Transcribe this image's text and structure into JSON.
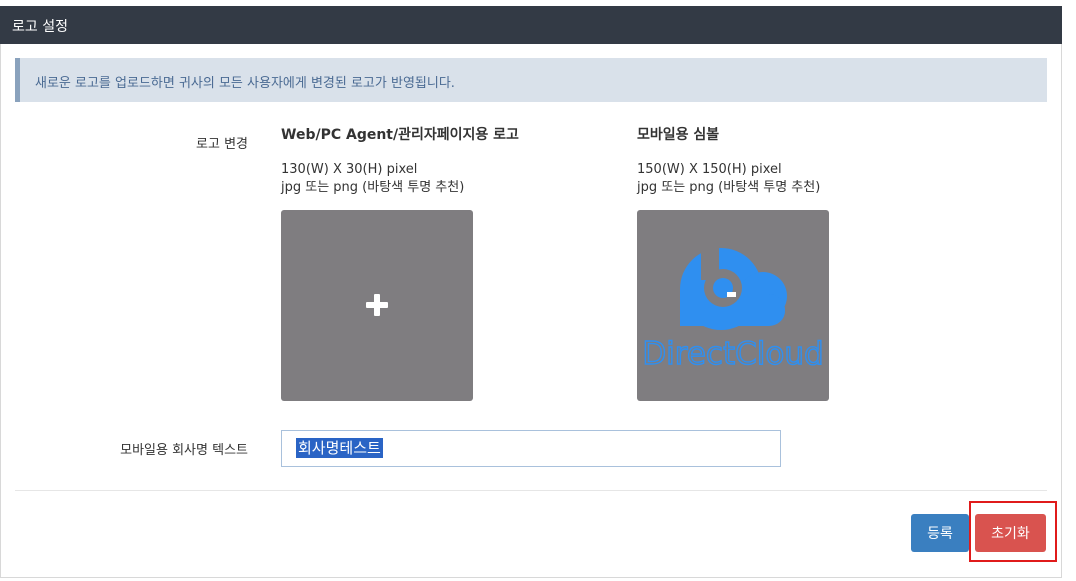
{
  "header": {
    "title": "로고 설정"
  },
  "notice": {
    "text": "새로운 로고를 업로드하면 귀사의 모든 사용자에게 변경된 로고가 반영됩니다."
  },
  "logo_section": {
    "label": "로고 변경",
    "web": {
      "title": "Web/PC Agent/관리자페이지용 로고",
      "size": "130(W) X 30(H) pixel",
      "format": "jpg 또는 png (바탕색 투명 추천)",
      "upload_icon": "plus-icon"
    },
    "mobile": {
      "title": "모바일용 심볼",
      "size": "150(W) X 150(H) pixel",
      "format": "jpg 또는 png (바탕색 투명 추천)",
      "logo_text": "DirectCloud",
      "logo_color": "#2f8ff0"
    }
  },
  "company_text": {
    "label": "모바일용 회사명 텍스트",
    "value": "회사명테스트"
  },
  "buttons": {
    "register": "등록",
    "reset": "초기화"
  },
  "colors": {
    "header_bg": "#333a45",
    "notice_bg": "#d9e1ea",
    "register_btn": "#3a7fc0",
    "reset_btn": "#d9534f"
  }
}
